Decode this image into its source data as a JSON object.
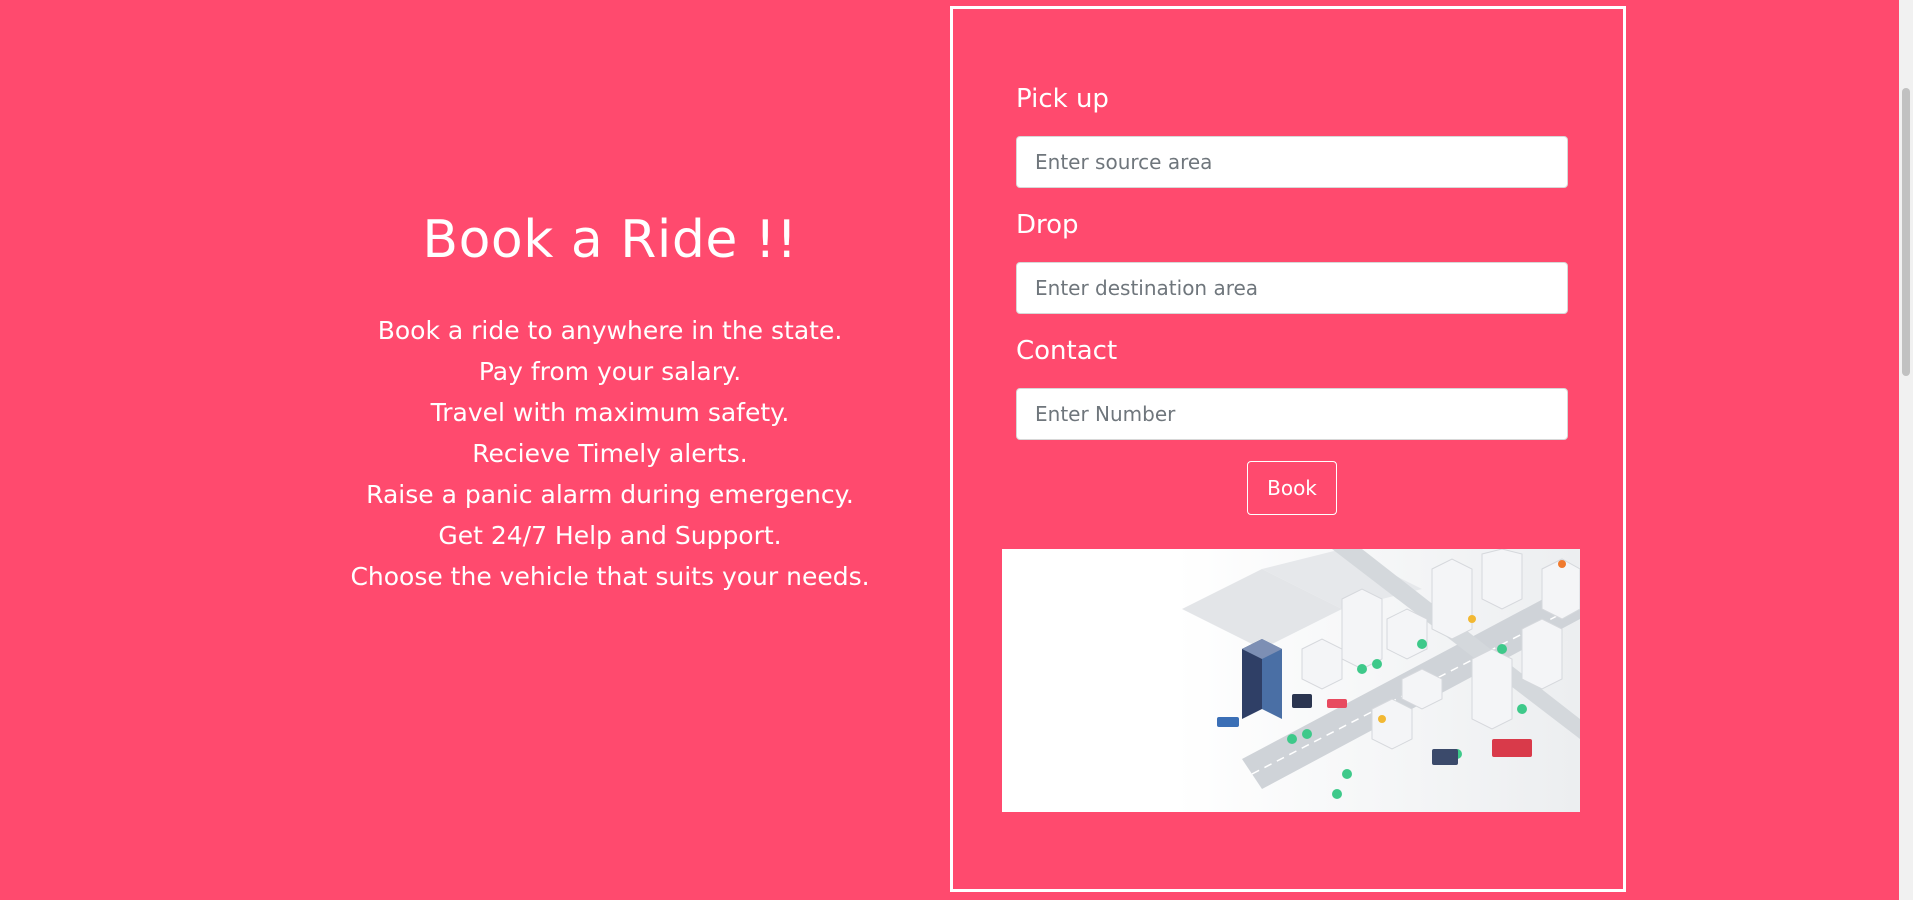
{
  "intro": {
    "title": "Book a Ride !!",
    "features": [
      "Book a ride to anywhere in the state.",
      "Pay from your salary.",
      "Travel with maximum safety.",
      "Recieve Timely alerts.",
      "Raise a panic alarm during emergency.",
      "Get 24/7 Help and Support.",
      "Choose the vehicle that suits your needs."
    ]
  },
  "form": {
    "pickup": {
      "label": "Pick up",
      "placeholder": "Enter source area",
      "value": ""
    },
    "drop": {
      "label": "Drop",
      "placeholder": "Enter destination area",
      "value": ""
    },
    "contact": {
      "label": "Contact",
      "placeholder": "Enter Number",
      "value": ""
    },
    "submit_label": "Book"
  },
  "colors": {
    "background": "#ff4a6e",
    "text": "#ffffff"
  },
  "illustration": {
    "icon": "isometric-city-illustration"
  }
}
